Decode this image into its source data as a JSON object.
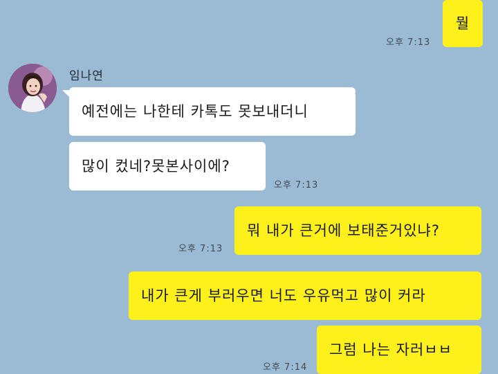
{
  "chat": {
    "partner_name": "임나연",
    "messages": [
      {
        "id": "m1",
        "from": "me",
        "text": "뭘",
        "time": "오후 7:13"
      },
      {
        "id": "m2",
        "from": "other",
        "text": "예전에는 나한테 카톡도 못보내더니",
        "time": ""
      },
      {
        "id": "m3",
        "from": "other",
        "text": "많이 컸네?못본사이에?",
        "time": "오후 7:13"
      },
      {
        "id": "m4",
        "from": "me",
        "text": "뭐 내가 큰거에 보태준거있냐?",
        "time": "오후 7:13"
      },
      {
        "id": "m5",
        "from": "me",
        "text": "내가 큰게 부러우면 너도 우유먹고 많이 커라",
        "time": ""
      },
      {
        "id": "m6",
        "from": "me",
        "text": "그럼 나는 자러ㅂㅂ",
        "time": "오후 7:14"
      }
    ]
  },
  "colors": {
    "background": "#9bbbd4",
    "my_bubble": "#fef01b",
    "other_bubble": "#ffffff"
  }
}
